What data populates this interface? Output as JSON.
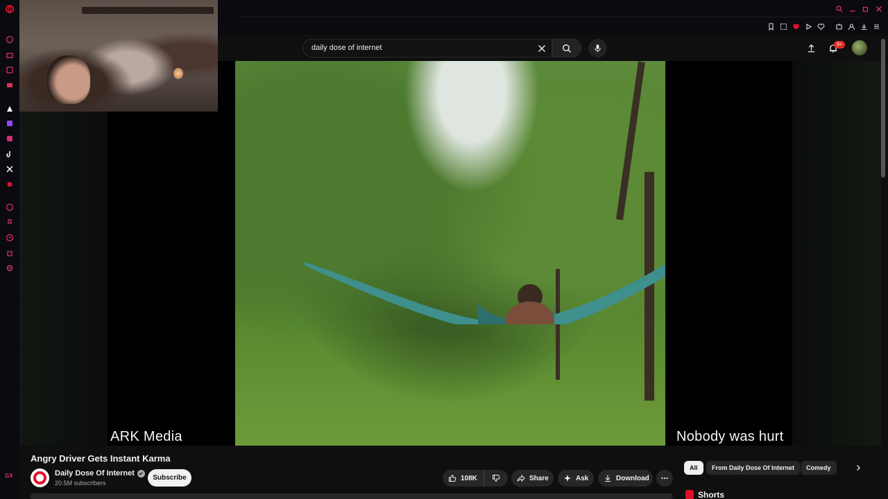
{
  "search": {
    "query": "daily dose of internet"
  },
  "header": {
    "notification_count": "9+"
  },
  "video": {
    "overlay_left": "ARK Media",
    "overlay_right": "Nobody was hurt",
    "title": "Angry Driver Gets Instant Karma"
  },
  "channel": {
    "name": "Daily Dose Of Internet",
    "subscribers": "20.5M subscribers",
    "subscribe_label": "Subscribe"
  },
  "actions": {
    "likes": "108K",
    "share": "Share",
    "ask": "Ask",
    "download": "Download"
  },
  "chips": [
    "All",
    "From Daily Dose Of Internet",
    "Comedy"
  ],
  "shorts": {
    "label": "Shorts"
  },
  "browser": {
    "gx_label": "GX"
  },
  "colors": {
    "accent": "#e0102b",
    "background": "#0f0f0f",
    "pill": "#272727"
  }
}
